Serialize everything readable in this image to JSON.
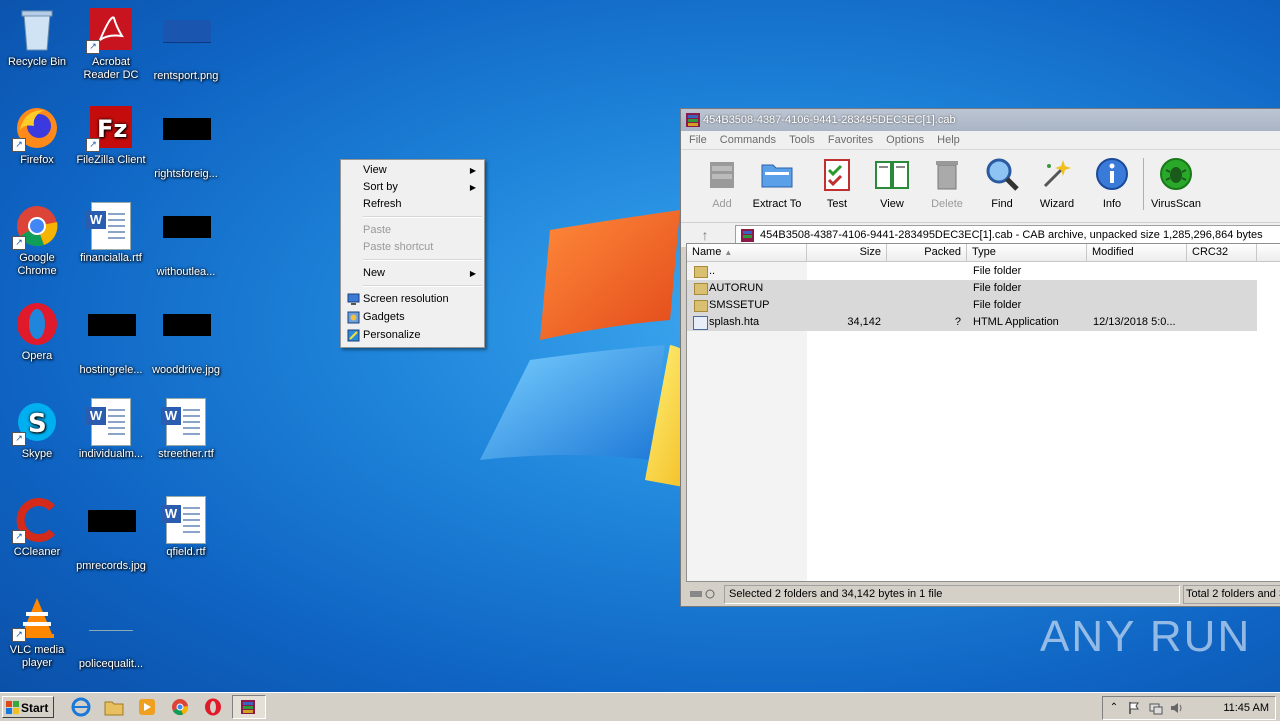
{
  "desktop": {
    "icons": [
      {
        "label": "Recycle Bin"
      },
      {
        "label": "Acrobat Reader DC"
      },
      {
        "label": "rentsport.png"
      },
      {
        "label": "Firefox"
      },
      {
        "label": "FileZilla Client"
      },
      {
        "label": "rightsforeig..."
      },
      {
        "label": "Google Chrome"
      },
      {
        "label": "financialla.rtf"
      },
      {
        "label": "withoutlea..."
      },
      {
        "label": "Opera"
      },
      {
        "label": "hostingrele..."
      },
      {
        "label": "wooddrive.jpg"
      },
      {
        "label": "Skype"
      },
      {
        "label": "individualm..."
      },
      {
        "label": "streether.rtf"
      },
      {
        "label": "CCleaner"
      },
      {
        "label": "pmrecords.jpg"
      },
      {
        "label": "qfield.rtf"
      },
      {
        "label": "VLC media player"
      },
      {
        "label": "policequalit..."
      }
    ],
    "watermark": "ANY RUN"
  },
  "context_menu": {
    "items": [
      {
        "label": "View",
        "submenu": true
      },
      {
        "label": "Sort by",
        "submenu": true
      },
      {
        "label": "Refresh"
      },
      {
        "label": "Paste",
        "disabled": true
      },
      {
        "label": "Paste shortcut",
        "disabled": true
      },
      {
        "label": "New",
        "submenu": true
      },
      {
        "label": "Screen resolution"
      },
      {
        "label": "Gadgets"
      },
      {
        "label": "Personalize"
      }
    ]
  },
  "winrar": {
    "title": "454B3508-4387-4106-9441-283495DEC3EC[1].cab",
    "menu": [
      "File",
      "Commands",
      "Tools",
      "Favorites",
      "Options",
      "Help"
    ],
    "toolbar": [
      "Add",
      "Extract To",
      "Test",
      "View",
      "Delete",
      "Find",
      "Wizard",
      "Info",
      "VirusScan"
    ],
    "address": "454B3508-4387-4106-9441-283495DEC3EC[1].cab - CAB archive, unpacked size 1,285,296,864 bytes",
    "columns": [
      "Name",
      "Size",
      "Packed",
      "Type",
      "Modified",
      "CRC32"
    ],
    "rows": [
      {
        "name": "..",
        "size": "",
        "packed": "",
        "type": "File folder",
        "modified": ""
      },
      {
        "name": "AUTORUN",
        "size": "",
        "packed": "",
        "type": "File folder",
        "modified": ""
      },
      {
        "name": "SMSSETUP",
        "size": "",
        "packed": "",
        "type": "File folder",
        "modified": ""
      },
      {
        "name": "splash.hta",
        "size": "34,142",
        "packed": "?",
        "type": "HTML Application",
        "modified": "12/13/2018 5:0..."
      }
    ],
    "status_left": "Selected 2 folders and 34,142 bytes in 1 file",
    "status_right": "Total 2 folders and 3"
  },
  "taskbar": {
    "start_label": "Start",
    "clock": "11:45 AM"
  }
}
